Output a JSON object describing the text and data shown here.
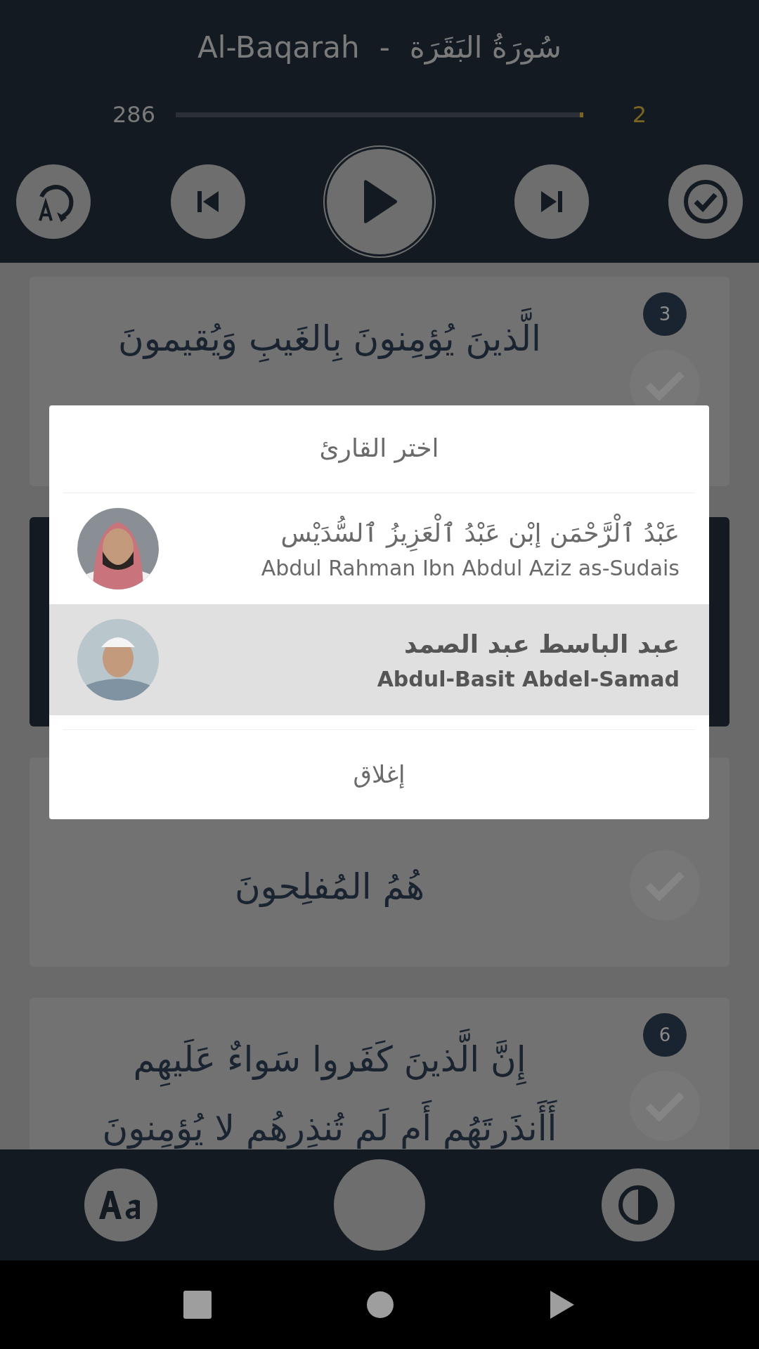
{
  "header": {
    "title_latin": "Al-Baqarah",
    "separator": "-",
    "title_arabic": "سُورَةُ البَقَرَة",
    "progress": {
      "total": "286",
      "current": "2",
      "level": 0.008
    }
  },
  "ayahs": [
    {
      "number": "3",
      "lines": [
        "الَّذينَ يُؤمِنونَ بِالغَيبِ وَيُقيمونَ"
      ],
      "selected": false
    },
    {
      "selected": true
    },
    {
      "lines": [
        "هُمُ المُفلِحونَ"
      ],
      "selected": false
    },
    {
      "number": "6",
      "lines": [
        "إِنَّ الَّذينَ كَفَروا سَواءٌ عَلَيهِم",
        "أَأَنذَرتَهُم أَم لَم تُنذِرهُم لا يُؤمِنونَ"
      ],
      "selected": false
    }
  ],
  "dialog": {
    "title": "اختر القارئ",
    "reciters": [
      {
        "name_arabic": "عَبْدُ ٱلْرَّحْمَن إبْن عَبْدُ ٱلْعَزِيزُ ٱلسُّدَيْس",
        "name_latin": "Abdul Rahman Ibn Abdul Aziz as-Sudais",
        "selected": false
      },
      {
        "name_arabic": "عبد الباسط عبد الصمد",
        "name_latin": "Abdul-Basit Abdel-Samad",
        "selected": true
      }
    ],
    "close": "إغلاق"
  }
}
